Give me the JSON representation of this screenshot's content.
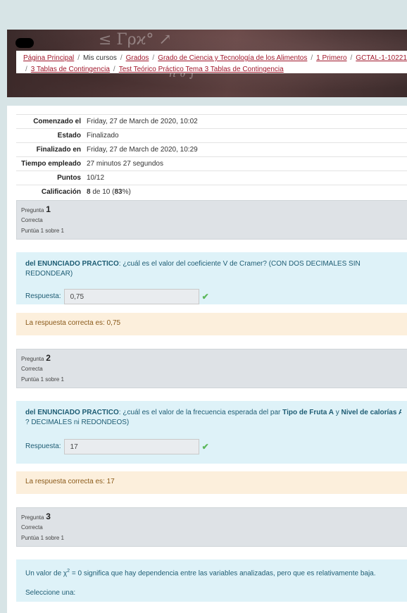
{
  "breadcrumb": {
    "line1": [
      "Página Principal",
      "Mis cursos",
      "Grados",
      "Grado de Ciencia y Tecnología de los Alimentos",
      "1 Primero",
      "GCTAL-1-10221"
    ],
    "line2": [
      "3 Tablas de Contingencia",
      "Test Teórico Práctico Tema 3 Tablas de Contingencia"
    ]
  },
  "summary": [
    {
      "k": "Comenzado el",
      "v": "Friday, 27 de March de 2020, 10:02"
    },
    {
      "k": "Estado",
      "v": "Finalizado"
    },
    {
      "k": "Finalizado en",
      "v": "Friday, 27 de March de 2020, 10:29"
    },
    {
      "k": "Tiempo empleado",
      "v": "27 minutos 27 segundos"
    },
    {
      "k": "Puntos",
      "v": "10/12"
    },
    {
      "k": "Calificación",
      "v_bold1": "8",
      "v_mid": " de 10 (",
      "v_bold2": "83",
      "v_end": "%)"
    }
  ],
  "questions": [
    {
      "prefix": "Pregunta",
      "number": "1",
      "status": "Correcta",
      "mark": "Puntúa 1 sobre 1",
      "text_bold": "del ENUNCIADO PRACTICO",
      "text": ": ¿cuál es el valor del coeficiente V de Cramer? (CON DOS DECIMALES SIN REDONDEAR)",
      "answer_label": "Respuesta:",
      "answer": "0,75",
      "feedback": "La respuesta correcta es: 0,75"
    },
    {
      "prefix": "Pregunta",
      "number": "2",
      "status": "Correcta",
      "mark": "Puntúa 1 sobre 1",
      "text_bold": "del ENUNCIADO PRACTICO",
      "text": ": ¿cuál es el valor de la frecuencia esperada del par ",
      "text_b2": "Tipo de Fruta A",
      "text_mid": " y ",
      "text_b3": "Nivel de calorías Alto",
      "text_end": "? DECIMALES ni REDONDEOS)",
      "answer_label": "Respuesta:",
      "answer": "17",
      "feedback": "La respuesta correcta es: 17"
    },
    {
      "prefix": "Pregunta",
      "number": "3",
      "status": "Correcta",
      "mark": "Puntúa 1 sobre 1",
      "text_pre": "Un valor de χ",
      "text_sup": "2",
      "text": " = 0 significa que hay dependencia entre las variables analizadas, pero que es relativamente baja.",
      "select_prompt": "Seleccione una:"
    }
  ],
  "colors": {
    "link": "#a0172b",
    "qtext_bg": "#def2f8",
    "feedback_bg": "#fcefdc",
    "check": "#5cb85c"
  }
}
